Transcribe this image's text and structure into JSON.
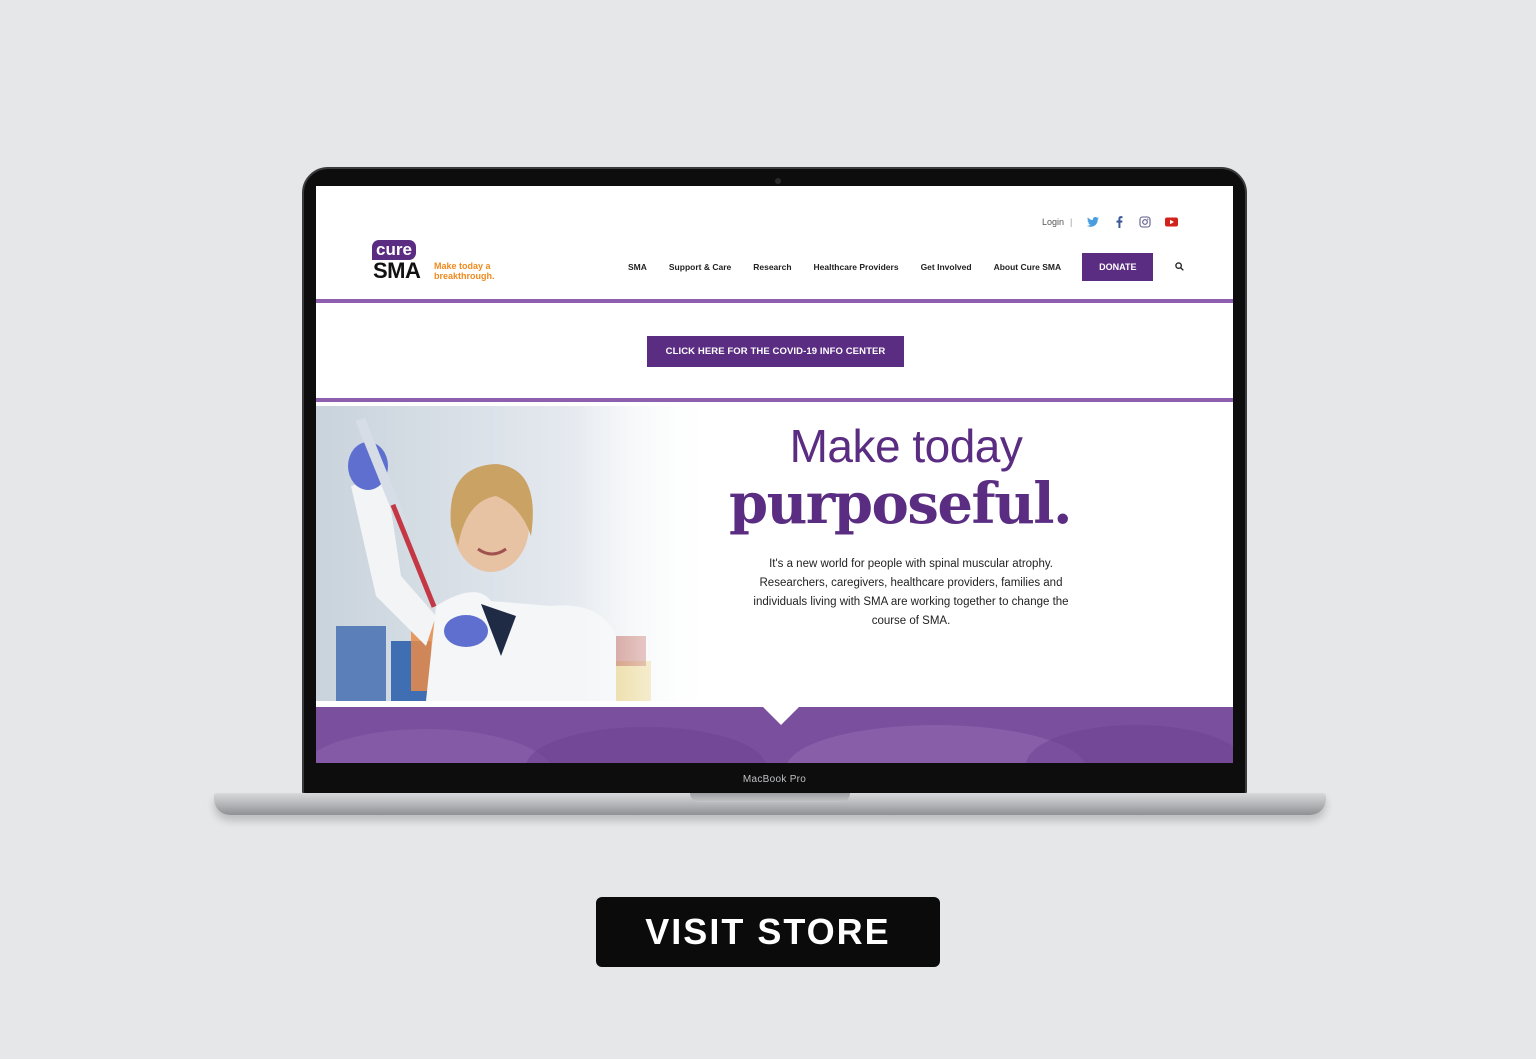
{
  "laptop": {
    "model_label": "MacBook Pro"
  },
  "site": {
    "logo": {
      "top_word": "cure",
      "bottom_word": "SMA",
      "tagline": "Make today a breakthrough."
    },
    "utility_links": {
      "login": "Login",
      "separator": "|",
      "social_icons": [
        "twitter-icon",
        "facebook-icon",
        "instagram-icon",
        "youtube-icon"
      ]
    },
    "nav": {
      "items": [
        "SMA",
        "Support & Care",
        "Research",
        "Healthcare Providers",
        "Get Involved",
        "About Cure SMA"
      ],
      "donate_label": "DONATE"
    },
    "covid_button": "CLICK HERE FOR THE COVID-19 INFO CENTER",
    "hero": {
      "headline_line1": "Make today",
      "headline_line2": "purposeful.",
      "body": "It's a new world for people with spinal muscular atrophy. Researchers, caregivers, healthcare providers, families and individuals living with SMA are working together to change the course of SMA."
    },
    "colors": {
      "brand_purple": "#5b2d82",
      "divider_purple": "#8e5fae",
      "band_purple": "#7a4f9d",
      "tagline_orange": "#f08a1d"
    }
  },
  "visit_store_button": "VISIT STORE"
}
